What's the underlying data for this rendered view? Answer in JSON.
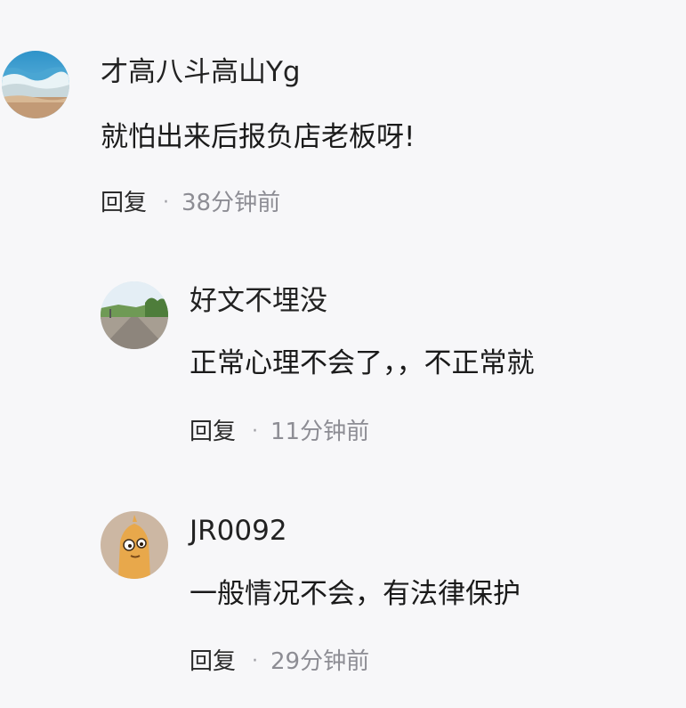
{
  "comments": [
    {
      "username": "才高八斗高山Yg",
      "content": "就怕出来后报负店老板呀!",
      "reply_label": "回复",
      "separator": "·",
      "time": "38分钟前"
    },
    {
      "username": "好文不埋没",
      "content": "正常心理不会了，，不正常就",
      "reply_label": "回复",
      "separator": "·",
      "time": "11分钟前"
    },
    {
      "username": "JR0092",
      "content": "一般情况不会，有法律保护",
      "reply_label": "回复",
      "separator": "·",
      "time": "29分钟前"
    }
  ],
  "avatars": [
    "ocean-wave-avatar",
    "road-landscape-avatar",
    "cartoon-character-avatar"
  ]
}
